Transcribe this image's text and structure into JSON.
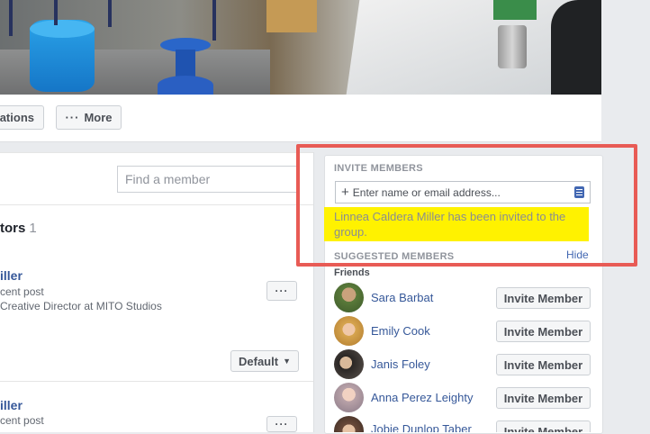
{
  "header": {
    "notifications_partial": "ations",
    "more_label": "More",
    "more_dots": "···"
  },
  "members": {
    "search_placeholder": "Find a member",
    "section_title": "tors",
    "section_count": "1",
    "rows": [
      {
        "name": "iller",
        "sub1": "cent post",
        "sub2": "Creative Director at MITO Studios"
      },
      {
        "name": "iller",
        "sub1": "cent post",
        "sub2": ""
      }
    ],
    "row_menu": "···",
    "default_label": "Default",
    "default_caret": "▼"
  },
  "invite": {
    "title": "INVITE MEMBERS",
    "input_placeholder": "Enter name or email address...",
    "plus": "+",
    "confirmation": "Linnea Caldera Miller has been invited to the group.",
    "suggested_title": "SUGGESTED MEMBERS",
    "hide_label": "Hide",
    "friends_label": "Friends",
    "invite_label": "Invite Member",
    "suggestions": [
      {
        "name": "Sara Barbat"
      },
      {
        "name": "Emily Cook"
      },
      {
        "name": "Janis Foley"
      },
      {
        "name": "Anna Perez Leighty"
      },
      {
        "name": "Jobie Dunlop Taber"
      }
    ]
  },
  "colors": {
    "link_blue": "#365899",
    "highlight_yellow": "#fff200",
    "annotation_red": "#e85b55"
  }
}
